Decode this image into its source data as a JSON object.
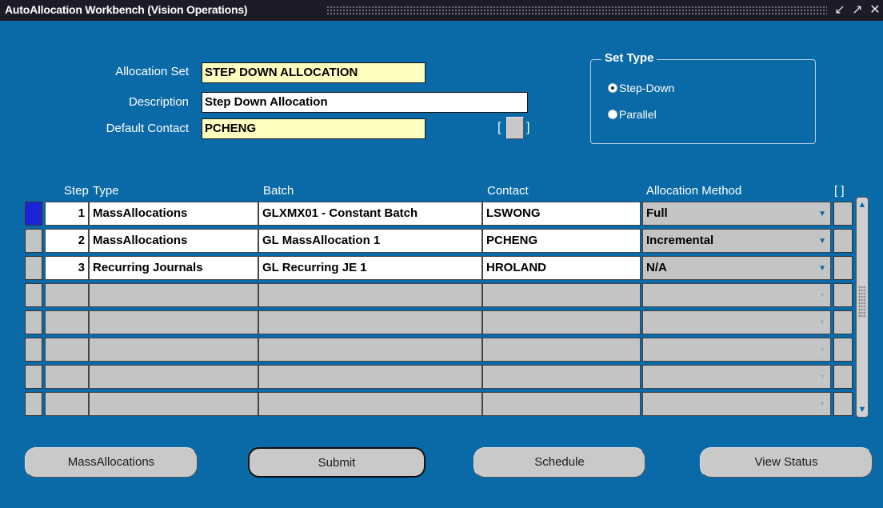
{
  "window": {
    "title": "AutoAllocation Workbench (Vision Operations)"
  },
  "header": {
    "allocation_set_label": "Allocation Set",
    "allocation_set_value": "STEP DOWN ALLOCATION",
    "description_label": "Description",
    "description_value": "Step Down Allocation",
    "default_contact_label": "Default Contact",
    "default_contact_value": "PCHENG",
    "bracket_open": "[",
    "bracket_close": "]"
  },
  "set_type": {
    "title": "Set Type",
    "options": [
      {
        "label": "Step-Down",
        "selected": true
      },
      {
        "label": "Parallel",
        "selected": false
      }
    ]
  },
  "table": {
    "columns": {
      "step": "Step",
      "type": "Type",
      "batch": "Batch",
      "contact": "Contact",
      "method": "Allocation Method",
      "brackets": "[ ]"
    },
    "rows": [
      {
        "step": "1",
        "type": "MassAllocations",
        "batch": "GLXMX01 - Constant Batch",
        "contact": "LSWONG",
        "method": "Full"
      },
      {
        "step": "2",
        "type": "MassAllocations",
        "batch": "GL MassAllocation 1",
        "contact": "PCHENG",
        "method": "Incremental"
      },
      {
        "step": "3",
        "type": "Recurring Journals",
        "batch": "GL Recurring JE 1",
        "contact": "HROLAND",
        "method": "N/A"
      }
    ],
    "empty_rows": 5
  },
  "buttons": {
    "massallocations": "MassAllocations",
    "submit": "Submit",
    "schedule": "Schedule",
    "view_status": "View Status"
  },
  "icons": {
    "dropdown": "chevron-down-icon",
    "scroll_up": "scroll-up-icon",
    "scroll_down": "scroll-down-icon",
    "minimize": "minimize-icon",
    "maximize": "maximize-icon",
    "close": "close-icon"
  },
  "colors": {
    "background": "#0a6aa8",
    "required_field": "#ffffc0",
    "current_record": "#1b24d8",
    "titlebar": "#1c1c28"
  }
}
